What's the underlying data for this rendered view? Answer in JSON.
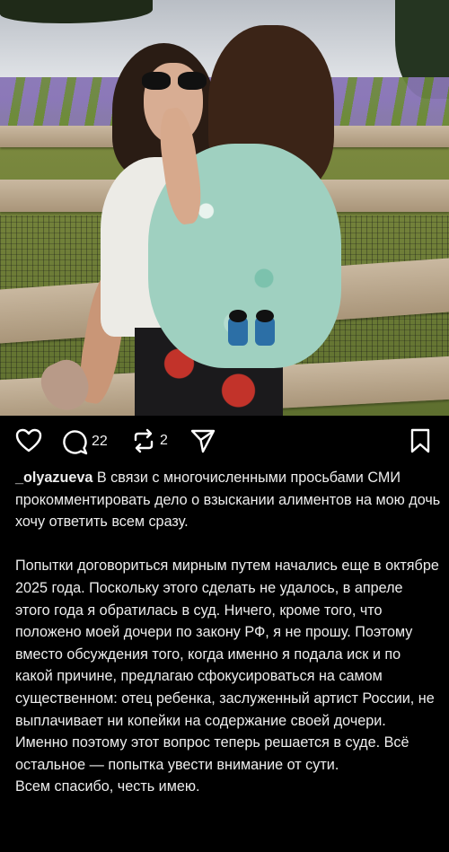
{
  "post": {
    "photo_alt": "post-photo",
    "likes_icon": "heart-icon",
    "comments_count": "22",
    "reposts_count": "2"
  },
  "caption": {
    "username": "_olyazueva",
    "p1": "В связи с многочисленными просьбами СМИ прокомментировать дело о взыскании алиментов на мою дочь хочу ответить всем сразу.",
    "p2": "Попытки договориться мирным путем начались еще в октябре 2025 года. Поскольку этого сделать не удалось, в апреле этого года я обратилась в суд. Ничего, кроме того, что положено моей дочери по закону РФ, я не прошу. Поэтому вместо обсуждения того, когда именно я подала иск и по какой причине, предлагаю сфокусироваться на самом существенном: отец ребенка, заслуженный артист России, не выплачивает ни копейки на содержание своей дочери. Именно поэтому этот вопрос теперь решается в суде. Всё остальное — попытка увести внимание от сути.",
    "p3": "Всем спасибо, честь имею."
  },
  "colors": {
    "background": "#000000",
    "text": "#ededed",
    "icon": "#ffffff"
  }
}
